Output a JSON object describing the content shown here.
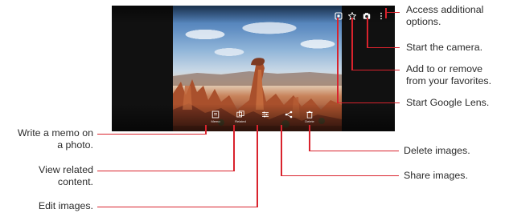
{
  "screen": {
    "top_actions": [
      {
        "name": "google-lens-icon"
      },
      {
        "name": "favorite-star-icon"
      },
      {
        "name": "camera-icon"
      },
      {
        "name": "more-options-icon"
      }
    ],
    "bottom_actions": [
      {
        "name": "memo-icon",
        "label": "Memo"
      },
      {
        "name": "related-icon",
        "label": "Related"
      },
      {
        "name": "edit-icon",
        "label": ""
      },
      {
        "name": "share-icon",
        "label": ""
      },
      {
        "name": "delete-icon",
        "label": "Delete"
      }
    ]
  },
  "annotations": {
    "options_1": "Access additional",
    "options_2": "options.",
    "camera": "Start the camera.",
    "favorites_1": "Add to or remove",
    "favorites_2": "from your favorites.",
    "lens": "Start Google Lens.",
    "memo_1": "Write a memo on",
    "memo_2": "a photo.",
    "related_1": "View related",
    "related_2": "content.",
    "edit": "Edit images.",
    "delete": "Delete images.",
    "share": "Share images."
  },
  "colors": {
    "callout_line": "#d9232d",
    "text": "#2b2b2b",
    "phone_frame": "#111111"
  }
}
